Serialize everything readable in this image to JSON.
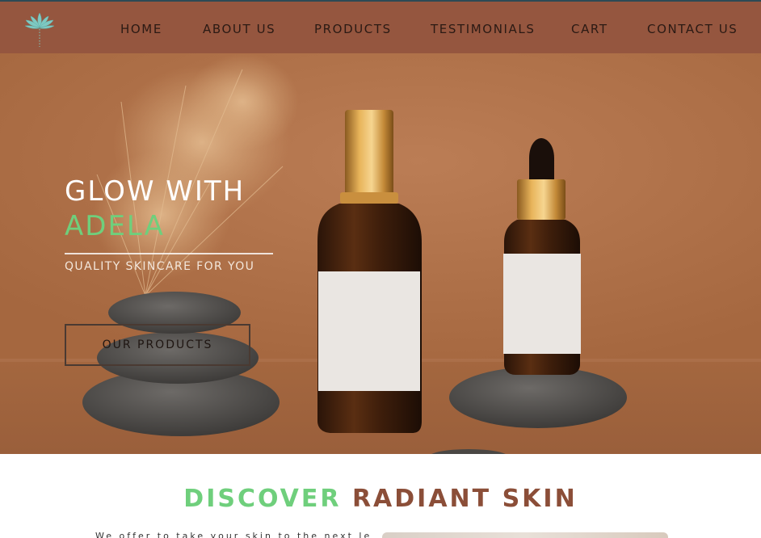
{
  "nav": {
    "items": [
      {
        "label": "HOME"
      },
      {
        "label": "ABOUT US"
      },
      {
        "label": "PRODUCTS"
      },
      {
        "label": "TESTIMONIALS"
      },
      {
        "label": "CART"
      },
      {
        "label": "CONTACT US"
      }
    ],
    "logo_icon": "lotus-icon"
  },
  "hero": {
    "title_line1": "GLOW WITH",
    "title_line2": "ADELA",
    "tagline": "QUALITY SKINCARE FOR YOU",
    "cta_label": "OUR PRODUCTS"
  },
  "discover": {
    "title_part1": "DISCOVER",
    "title_part2": "RADIANT SKIN",
    "intro_text": "We offer to take your skin to the next level"
  },
  "colors": {
    "nav_bg": "#95563f",
    "accent_green": "#6fcf7c",
    "brown_text": "#8b4e38",
    "hero_bg": "#b3764f"
  }
}
